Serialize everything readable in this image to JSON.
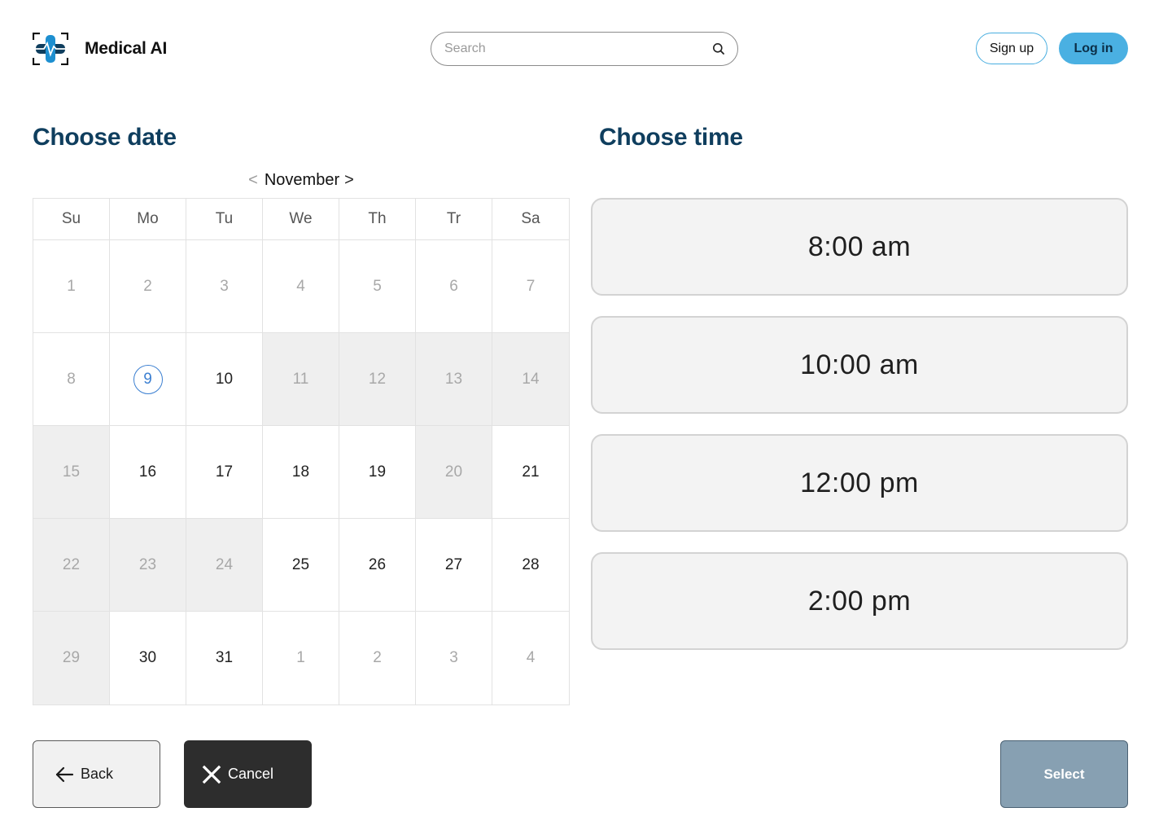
{
  "header": {
    "app_name": "Medical AI",
    "logo_icon": "medical-cross-logo",
    "search_placeholder": "Search",
    "search_icon": "search-icon",
    "signup_label": "Sign up",
    "login_label": "Log in"
  },
  "date_section": {
    "title": "Choose date",
    "month": "November",
    "prev_symbol": "<",
    "next_symbol": ">",
    "weekdays": [
      "Su",
      "Mo",
      "Tu",
      "We",
      "Th",
      "Tr",
      "Sa"
    ],
    "days": [
      {
        "label": "1",
        "state": "muted"
      },
      {
        "label": "2",
        "state": "muted"
      },
      {
        "label": "3",
        "state": "muted"
      },
      {
        "label": "4",
        "state": "muted"
      },
      {
        "label": "5",
        "state": "muted"
      },
      {
        "label": "6",
        "state": "muted"
      },
      {
        "label": "7",
        "state": "muted"
      },
      {
        "label": "8",
        "state": "muted"
      },
      {
        "label": "9",
        "state": "today"
      },
      {
        "label": "10",
        "state": "available"
      },
      {
        "label": "11",
        "state": "unavailable"
      },
      {
        "label": "12",
        "state": "unavailable"
      },
      {
        "label": "13",
        "state": "unavailable"
      },
      {
        "label": "14",
        "state": "unavailable"
      },
      {
        "label": "15",
        "state": "unavailable"
      },
      {
        "label": "16",
        "state": "available"
      },
      {
        "label": "17",
        "state": "available"
      },
      {
        "label": "18",
        "state": "available"
      },
      {
        "label": "19",
        "state": "available"
      },
      {
        "label": "20",
        "state": "unavailable"
      },
      {
        "label": "21",
        "state": "available"
      },
      {
        "label": "22",
        "state": "unavailable"
      },
      {
        "label": "23",
        "state": "unavailable"
      },
      {
        "label": "24",
        "state": "unavailable"
      },
      {
        "label": "25",
        "state": "available"
      },
      {
        "label": "26",
        "state": "available"
      },
      {
        "label": "27",
        "state": "available"
      },
      {
        "label": "28",
        "state": "available"
      },
      {
        "label": "29",
        "state": "unavailable"
      },
      {
        "label": "30",
        "state": "available"
      },
      {
        "label": "31",
        "state": "available"
      },
      {
        "label": "1",
        "state": "muted"
      },
      {
        "label": "2",
        "state": "muted"
      },
      {
        "label": "3",
        "state": "muted"
      },
      {
        "label": "4",
        "state": "muted"
      }
    ]
  },
  "time_section": {
    "title": "Choose time",
    "slots": [
      "8:00 am",
      "10:00 am",
      "12:00 pm",
      "2:00 pm"
    ]
  },
  "footer": {
    "back_label": "Back",
    "back_icon": "arrow-left-icon",
    "cancel_label": "Cancel",
    "cancel_icon": "close-icon",
    "select_label": "Select"
  },
  "colors": {
    "primary": "#4ab0e2",
    "heading": "#0f3e5e",
    "today_ring": "#3b7fd1",
    "unavailable_bg": "#efefef",
    "select_disabled": "#87a0b2"
  }
}
